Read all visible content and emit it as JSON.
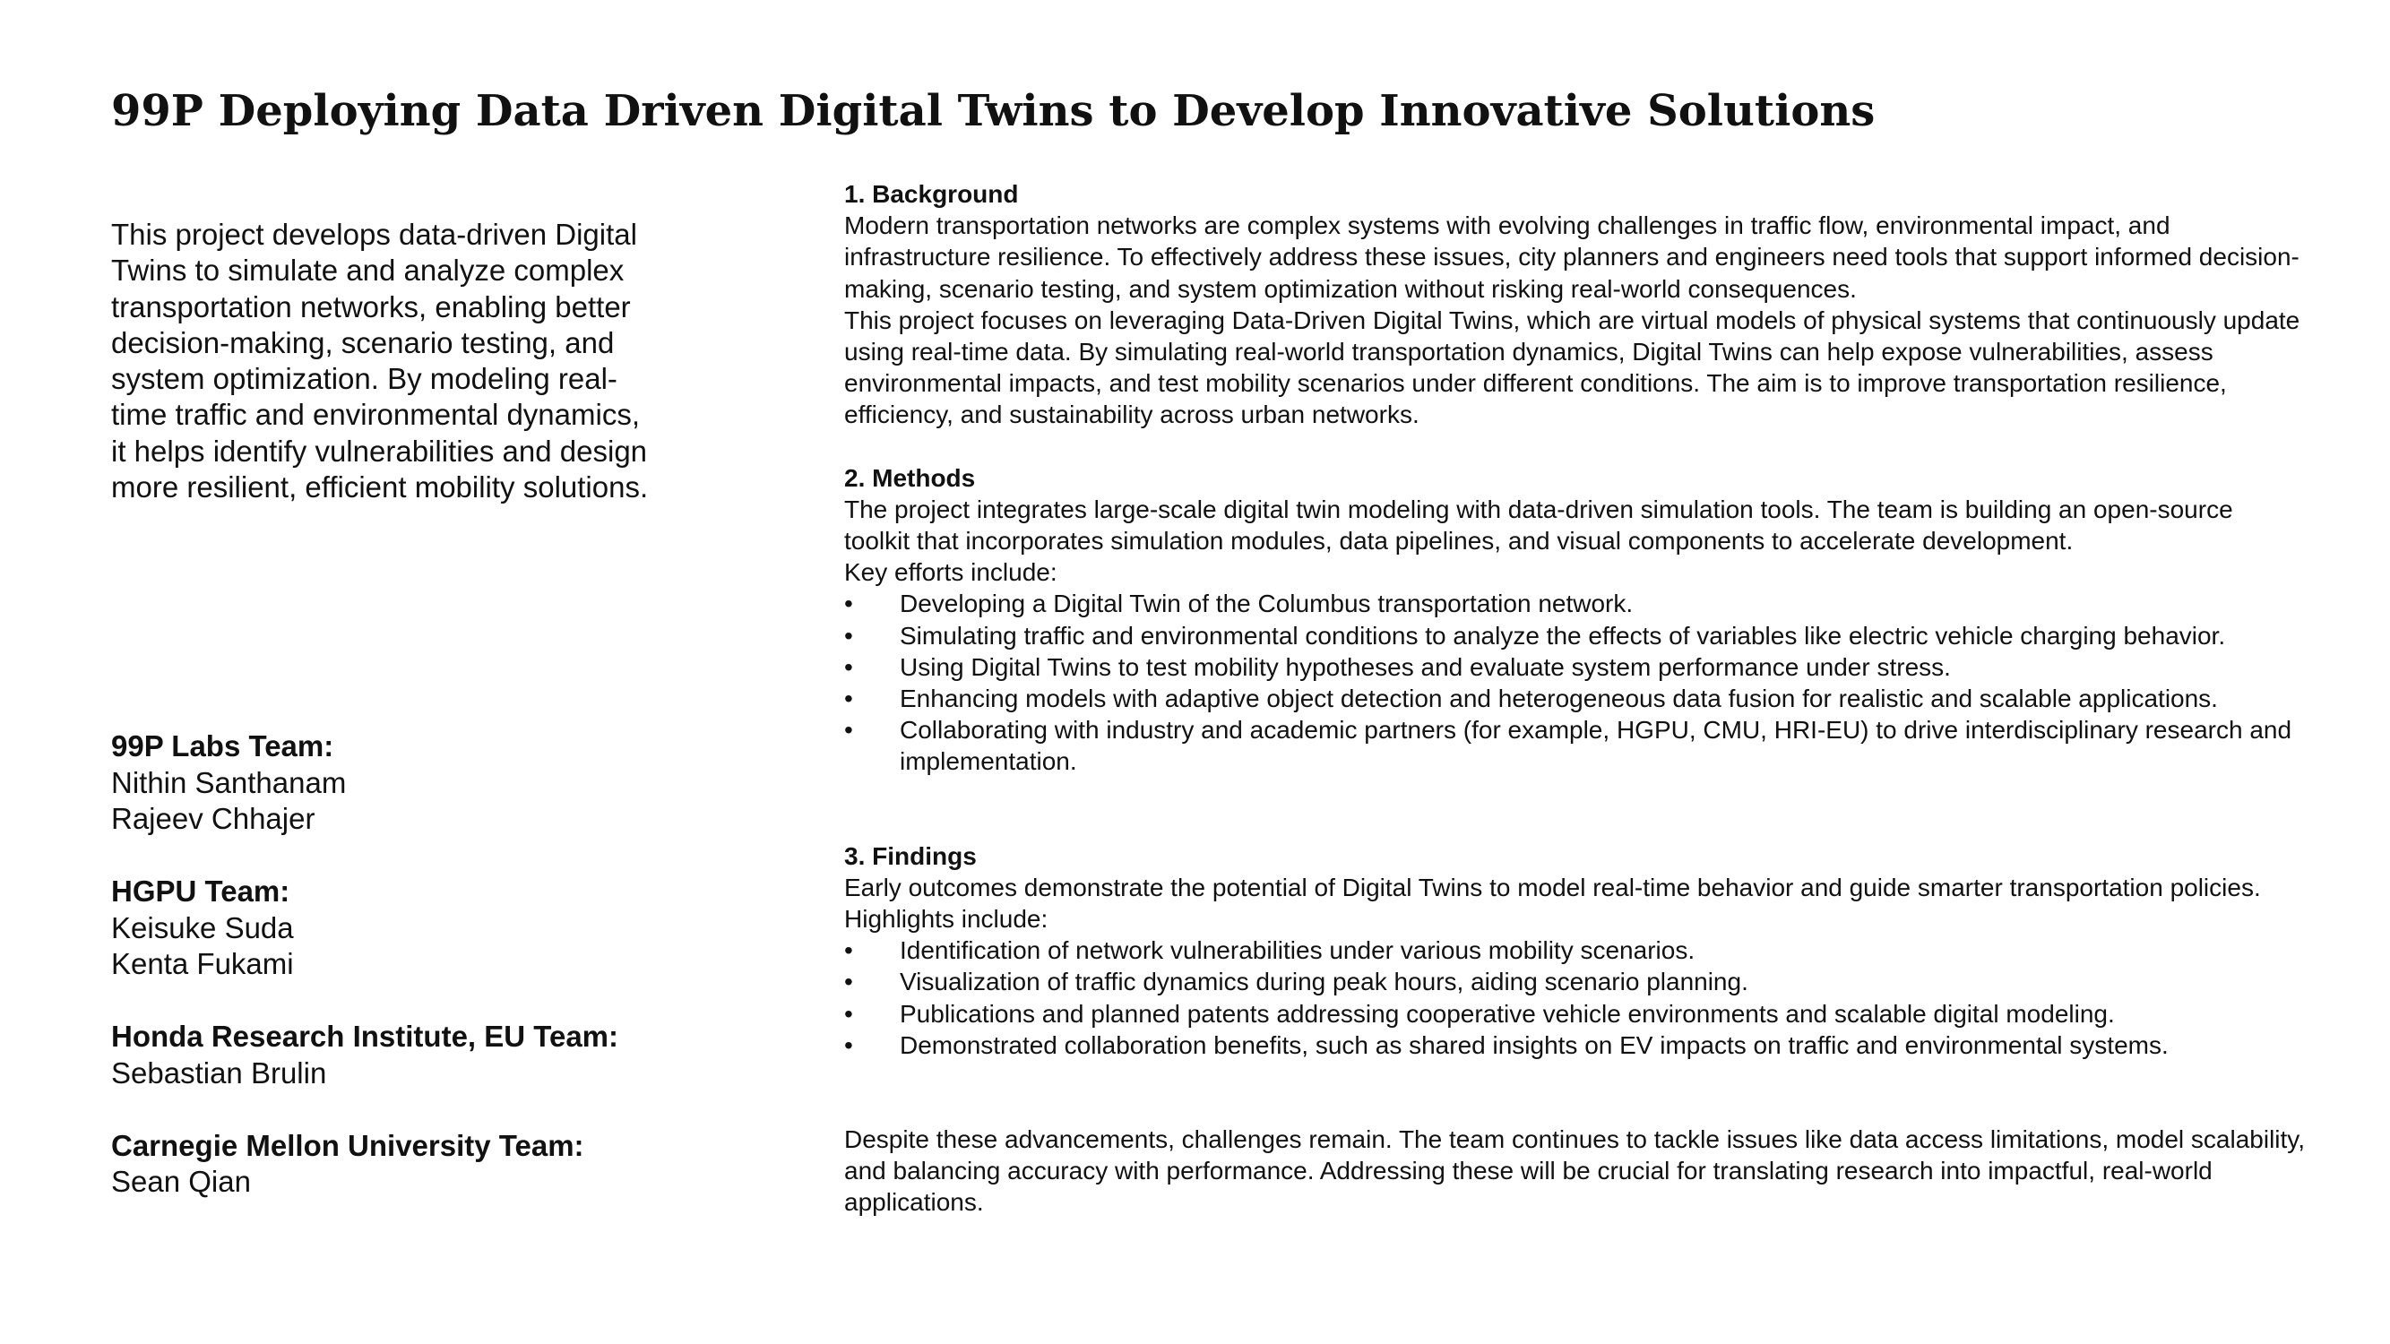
{
  "title": "99P Deploying Data Driven Digital Twins to Develop Innovative Solutions",
  "summary": "This project develops data-driven Digital Twins to simulate and analyze complex transportation networks, enabling better decision-making, scenario testing, and system optimization. By modeling real-time traffic and environmental dynamics, it helps identify vulnerabilities and design more resilient, efficient mobility solutions.",
  "teams": [
    {
      "name": "99P Labs Team:",
      "members": [
        "Nithin Santhanam",
        "Rajeev Chhajer"
      ]
    },
    {
      "name": "HGPU Team:",
      "members": [
        "Keisuke Suda",
        "Kenta Fukami"
      ]
    },
    {
      "name": "Honda Research Institute, EU Team:",
      "members": [
        "Sebastian Brulin"
      ]
    },
    {
      "name": "Carnegie Mellon University Team:",
      "members": [
        "Sean Qian"
      ]
    }
  ],
  "background": {
    "heading": "1. Background",
    "p1": "Modern transportation networks are complex systems with evolving challenges in traffic flow, environmental impact, and infrastructure resilience. To effectively address these issues, city planners and engineers need tools that support informed decision-making, scenario testing, and system optimization without risking real-world consequences.",
    "p2": "This project focuses on leveraging Data-Driven Digital Twins, which are virtual models of physical systems that continuously update using real-time data. By simulating real-world transportation dynamics, Digital Twins can help expose vulnerabilities, assess environmental impacts, and test mobility scenarios under different conditions. The aim is to improve transportation resilience, efficiency, and sustainability across urban networks."
  },
  "methods": {
    "heading": "2. Methods",
    "p1": "The project integrates large-scale digital twin modeling with data-driven simulation tools. The team is building an open-source toolkit that incorporates simulation modules, data pipelines, and visual components to accelerate development.",
    "p2": "Key efforts include:",
    "bullets": [
      "Developing a Digital Twin of the Columbus transportation network.",
      "Simulating traffic and environmental conditions to analyze the effects of variables like electric vehicle charging behavior.",
      "Using Digital Twins to test mobility hypotheses and evaluate system performance under stress.",
      "Enhancing models with adaptive object detection and heterogeneous data fusion for realistic and scalable applications.",
      "Collaborating with industry and academic partners (for example, HGPU, CMU, HRI-EU) to drive interdisciplinary research and implementation."
    ]
  },
  "findings": {
    "heading": "3. Findings",
    "p1": "Early outcomes demonstrate the potential of Digital Twins to model real-time behavior and guide smarter transportation policies. Highlights include:",
    "bullets": [
      "Identification of network vulnerabilities under various mobility scenarios.",
      "Visualization of traffic dynamics during peak hours, aiding scenario planning.",
      "Publications and planned patents addressing cooperative vehicle environments and scalable digital modeling.",
      "Demonstrated collaboration benefits, such as shared insights on EV impacts on traffic and environmental systems."
    ]
  },
  "closing": "Despite these advancements, challenges remain. The team continues to tackle issues like data access limitations, model scalability, and balancing accuracy with performance. Addressing these will be crucial for translating research into impactful, real-world applications.",
  "bullet_char": "•"
}
